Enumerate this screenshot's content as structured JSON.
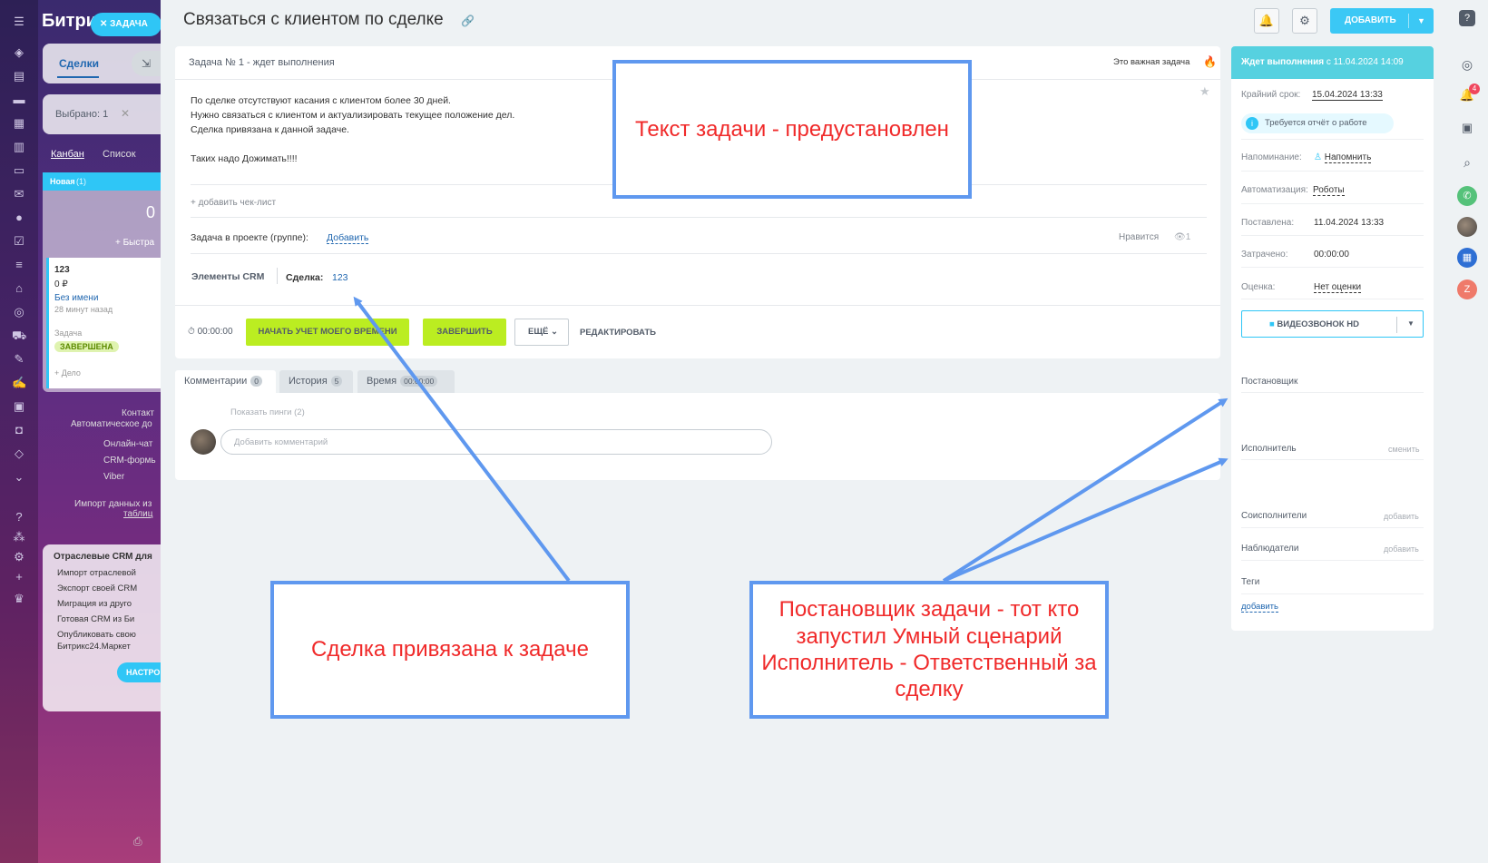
{
  "bg": {
    "logo": "Битри",
    "task_chip": "ЗАДАЧА",
    "deals_tab": "Сделки",
    "selected": "Выбрано: 1",
    "view_kanban": "Канбан",
    "view_list": "Список",
    "stage_new": "Новая",
    "stage_count": "(1)",
    "stage_sum": "0",
    "quick_add": "+ Быстра",
    "deal_title": "123",
    "deal_sum": "0 ₽",
    "deal_client": "Без имени",
    "deal_time": "28 минут назад",
    "deal_task_label": "Задача",
    "deal_status": "ЗАВЕРШЕНА",
    "deal_add": "+ Дело",
    "contacts": "Контакт",
    "auto": "Автоматическое до",
    "chat": "Онлайн-чат",
    "forms": "CRM-формь",
    "viber": "Viber",
    "import1": "Импорт данных из",
    "import2": "таблиц",
    "industry_title": "Отраслевые CRM для",
    "industry_items": [
      "Импорт отраслевой",
      "Экспорт своей CRM",
      "Миграция из друго",
      "Готовая CRM из Би",
      "Опубликовать свою",
      "Битрикс24.Маркет"
    ],
    "setup_btn": "НАСТРО"
  },
  "header": {
    "title": "Связаться с клиентом по сделке",
    "add_button": "ДОБАВИТЬ"
  },
  "task": {
    "status_line": "Задача № 1 - ждет выполнения",
    "important": "Это важная задача",
    "description": [
      "По сделке отсутствуют касания с клиентом более 30 дней.",
      "Нужно связаться с клиентом и актуализировать текущее положение дел.",
      "Сделка привязана к данной задаче.",
      "",
      "Таких надо Дожимать!!!!"
    ],
    "add_checklist": "+ добавить чек-лист",
    "project_label": "Задача в проекте (группе):",
    "project_add": "Добавить",
    "like": "Нравится",
    "views": "1",
    "crm_label": "Элементы CRM",
    "deal_label": "Сделка:",
    "deal_link": "123",
    "timer": "00:00:00",
    "btn_start_time": "НАЧАТЬ УЧЕТ МОЕГО ВРЕМЕНИ",
    "btn_finish": "ЗАВЕРШИТЬ",
    "btn_more": "ЕЩЁ",
    "btn_edit": "РЕДАКТИРОВАТЬ"
  },
  "tabs": [
    {
      "label": "Комментарии",
      "count": "0"
    },
    {
      "label": "История",
      "count": "5"
    },
    {
      "label": "Время",
      "count": "00:00:00"
    }
  ],
  "comments": {
    "show_pings": "Показать пинги (2)",
    "placeholder": "Добавить комментарий"
  },
  "sidebar": {
    "status": "Ждет выполнения",
    "status_since": "с 11.04.2024 14:09",
    "deadline_label": "Крайний срок:",
    "deadline": "15.04.2024 13:33",
    "report_badge": "Требуется отчёт о работе",
    "remind_label": "Напоминание:",
    "remind": "Напомнить",
    "automation_label": "Автоматизация:",
    "automation": "Роботы",
    "set_label": "Поставлена:",
    "set": "11.04.2024 13:33",
    "spent_label": "Затрачено:",
    "spent": "00:00:00",
    "rating_label": "Оценка:",
    "rating": "Нет оценки",
    "video_btn": "ВИДЕОЗВОНОК HD",
    "creator_label": "Постановщик",
    "assignee_label": "Исполнитель",
    "assignee_change": "сменить",
    "coassignees_label": "Соисполнители",
    "coassignees_add": "добавить",
    "observers_label": "Наблюдатели",
    "observers_add": "добавить",
    "tags_label": "Теги",
    "tags_add": "добавить"
  },
  "right_bar": {
    "notifications": "4"
  },
  "annotations": {
    "text_preset": "Текст задачи - предустановлен",
    "deal_linked": "Сделка привязана к задаче",
    "roles": "Постановщик задачи - тот кто запустил Умный сценарий Исполнитель - Ответственный за сделку"
  },
  "colors": {
    "accent": "#3bc8f5",
    "green": "#bbed21",
    "status": "#56d1e0",
    "arrow": "#5f98ef",
    "annotation_text": "#f02a2a"
  }
}
